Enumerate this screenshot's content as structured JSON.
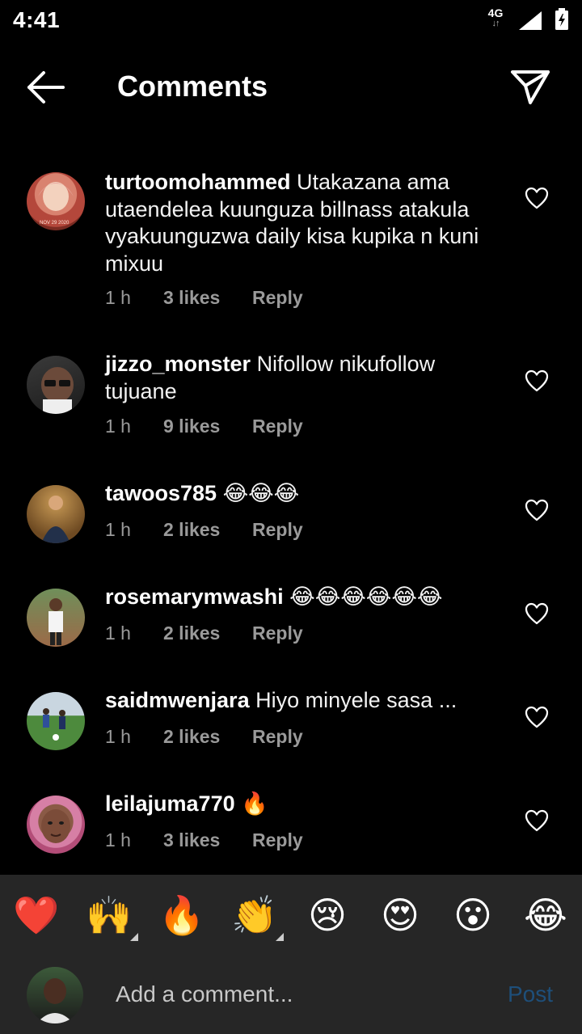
{
  "status_bar": {
    "time": "4:41",
    "network": "4G",
    "network_arrows": "↓↑",
    "signal_icon": "cell-signal-icon",
    "battery_icon": "battery-charging-icon"
  },
  "header": {
    "title": "Comments",
    "back_icon": "arrow-left-icon",
    "share_icon": "paper-plane-icon"
  },
  "comments": [
    {
      "username": "turtoomohammed",
      "text": "Utakazana ama utaendelea kuunguza billnass atakula vyakuunguzwa daily kisa kupika n kuni mixuu",
      "time": "1 h",
      "likes": "3 likes",
      "reply": "Reply",
      "avatar_caption": "NOV 29 2020"
    },
    {
      "username": "jizzo_monster",
      "text": "Nifollow nikufollow tujuane",
      "time": "1 h",
      "likes": "9 likes",
      "reply": "Reply"
    },
    {
      "username": "tawoos785",
      "text": "😂😂😂",
      "time": "1 h",
      "likes": "2 likes",
      "reply": "Reply"
    },
    {
      "username": "rosemarymwashi",
      "text": "😂😂😂😂😂😂",
      "time": "1 h",
      "likes": "2 likes",
      "reply": "Reply"
    },
    {
      "username": "saidmwenjara",
      "text": "Hiyo minyele sasa ...",
      "time": "1 h",
      "likes": "2 likes",
      "reply": "Reply"
    },
    {
      "username": "leilajuma770",
      "text": "🔥",
      "time": "1 h",
      "likes": "3 likes",
      "reply": "Reply"
    }
  ],
  "emoji_bar": [
    {
      "glyph": "❤️",
      "name": "red-heart"
    },
    {
      "glyph": "🙌",
      "name": "raising-hands"
    },
    {
      "glyph": "🔥",
      "name": "fire"
    },
    {
      "glyph": "👏",
      "name": "clapping-hands"
    },
    {
      "glyph": "😢",
      "name": "crying-face"
    },
    {
      "glyph": "😍",
      "name": "heart-eyes"
    },
    {
      "glyph": "😮",
      "name": "open-mouth"
    },
    {
      "glyph": "😂",
      "name": "tears-of-joy"
    }
  ],
  "composer": {
    "placeholder": "Add a comment...",
    "value": "",
    "post_label": "Post"
  },
  "colors": {
    "background": "#000000",
    "bottom_bar": "#262626",
    "meta_text": "#9a9a9a",
    "post_disabled": "#1e4f7a"
  }
}
